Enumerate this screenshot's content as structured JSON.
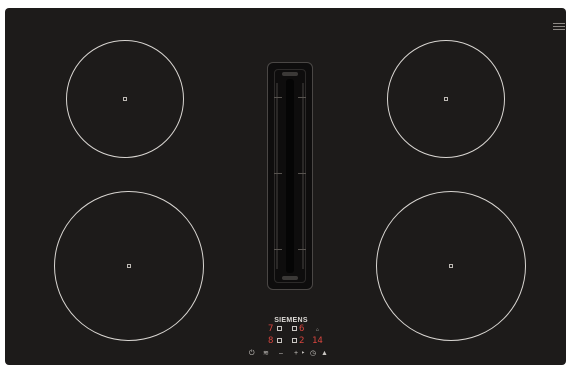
{
  "brand": "SIEMENS",
  "displays": {
    "top_left_level": "7",
    "top_right_level": "6",
    "bottom_left_level": "8",
    "bottom_right_level": "2",
    "vent_timer": "14"
  },
  "controls": {
    "power_icon": "power-icon",
    "fan_icon": "fan-icon",
    "minus_label": "–",
    "plus_label": "+",
    "timer_icon": "timer-icon",
    "warning_icon": "warning-icon"
  },
  "colors": {
    "surface": "#1d1b1a",
    "zone_ring": "#d9d6d2",
    "display_red": "#d8453e"
  }
}
